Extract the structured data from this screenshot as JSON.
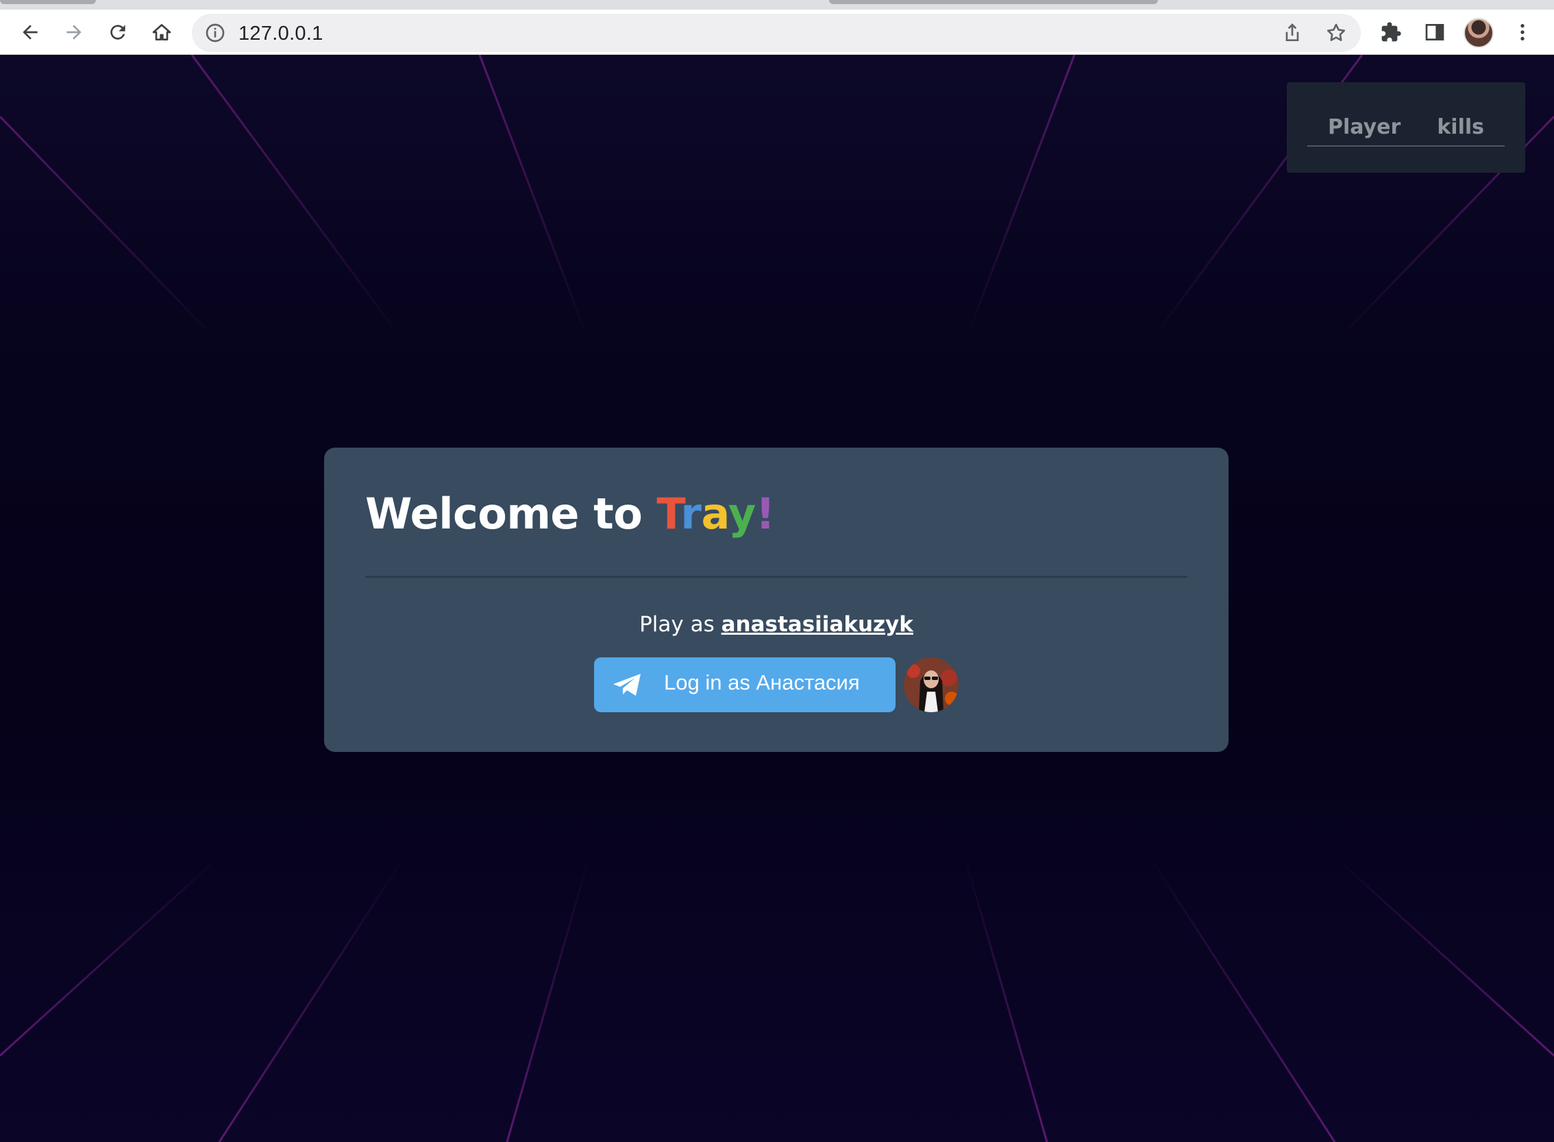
{
  "browser": {
    "url": "127.0.0.1",
    "icons": {
      "back": "back-arrow-icon",
      "forward": "forward-arrow-icon",
      "reload": "reload-icon",
      "home": "home-icon",
      "site_info": "info-icon",
      "share": "share-icon",
      "bookmark": "star-icon",
      "extensions": "puzzle-icon",
      "side_panel": "side-panel-icon",
      "menu": "kebab-menu-icon"
    }
  },
  "scoreboard": {
    "columns": [
      "Player",
      "kills"
    ]
  },
  "welcome": {
    "title_prefix": "Welcome to ",
    "brand_letters": [
      {
        "char": "T",
        "color": "#e8553e"
      },
      {
        "char": "r",
        "color": "#4a90d9"
      },
      {
        "char": "a",
        "color": "#f2c12e"
      },
      {
        "char": "y",
        "color": "#4cb050"
      },
      {
        "char": "!",
        "color": "#9b59b6"
      }
    ],
    "play_as_label": "Play as",
    "username": "anastasiiakuzyk"
  },
  "telegram_login": {
    "button_label": "Log in as Анастасия",
    "button_color": "#54a9eb",
    "icon": "telegram-plane-icon"
  },
  "colors": {
    "background": "#06031c",
    "card": "#384b5f",
    "scoreboard": "#1c2330",
    "grid_line": "#4a1a5e"
  }
}
